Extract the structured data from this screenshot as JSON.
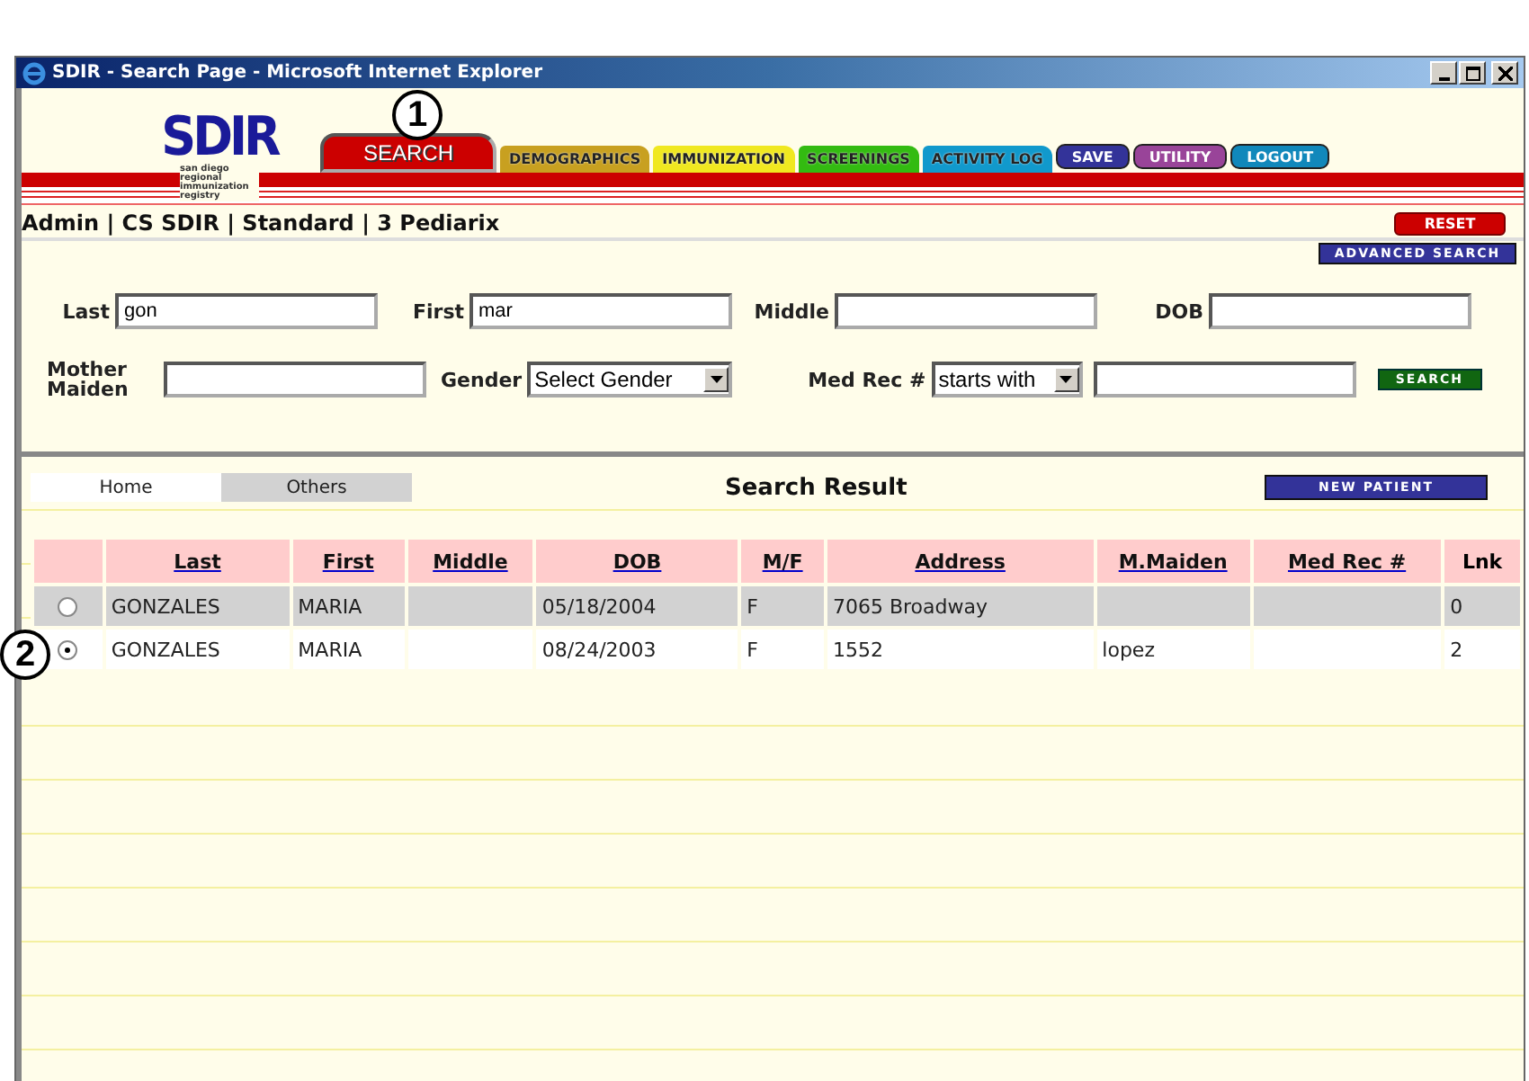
{
  "window": {
    "title": "SDIR - Search Page - Microsoft Internet Explorer"
  },
  "logo": {
    "text": "SDIR",
    "subtitle": "san diego regional immunization registry"
  },
  "nav": [
    {
      "label": "SEARCH",
      "kind": "tab",
      "color": "#cc0000",
      "selected": true
    },
    {
      "label": "DEMOGRAPHICS",
      "kind": "tab",
      "color": "#c8a020",
      "selected": false
    },
    {
      "label": "IMMUNIZATION",
      "kind": "tab",
      "color": "#f0e820",
      "selected": false
    },
    {
      "label": "SCREENINGS",
      "kind": "tab",
      "color": "#33bb11",
      "selected": false
    },
    {
      "label": "ACTIVITY LOG",
      "kind": "tab",
      "color": "#1199cc",
      "selected": false
    },
    {
      "label": "SAVE",
      "kind": "button",
      "color": "#333399"
    },
    {
      "label": "UTILITY",
      "kind": "button",
      "color": "#994499"
    },
    {
      "label": "LOGOUT",
      "kind": "button",
      "color": "#1188bb"
    }
  ],
  "user_info": "Admin | CS SDIR | Standard | 3 Pediarix",
  "reset_button": "RESET",
  "advanced_search_button": "ADVANCED SEARCH",
  "form": {
    "last": {
      "label": "Last",
      "value": "gon"
    },
    "first": {
      "label": "First",
      "value": "mar"
    },
    "middle": {
      "label": "Middle"
    },
    "dob": {
      "label": "DOB"
    },
    "mother_maiden": {
      "label": "Mother Maiden"
    },
    "gender": {
      "label": "Gender",
      "value": "Select Gender"
    },
    "med_rec": {
      "label": "Med Rec #",
      "mode": "starts with"
    },
    "search_button": "SEARCH"
  },
  "result_tabs": [
    {
      "label": "Home",
      "selected": true
    },
    {
      "label": "Others",
      "selected": false
    }
  ],
  "result_title": "Search Result",
  "new_patient_button": "NEW PATIENT",
  "table": {
    "columns": [
      "Last",
      "First",
      "Middle",
      "DOB",
      "M/F",
      "Address",
      "M.Maiden",
      "Med Rec #",
      "Lnk"
    ],
    "rows": [
      {
        "selected": false,
        "cells": [
          "GONZALES",
          "MARIA",
          "",
          "05/18/2004",
          "F",
          "7065 Broadway",
          "",
          "",
          "0"
        ]
      },
      {
        "selected": true,
        "cells": [
          "GONZALES",
          "MARIA",
          "",
          "08/24/2003",
          "F",
          "1552",
          "lopez",
          "",
          "2"
        ]
      }
    ]
  },
  "callouts": [
    "1",
    "2"
  ]
}
